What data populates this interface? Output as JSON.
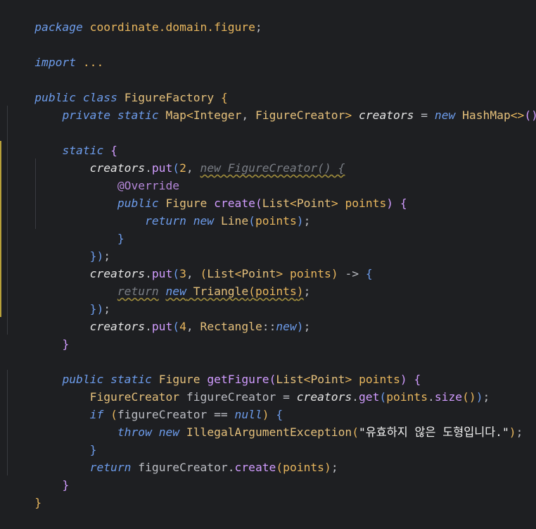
{
  "code": {
    "l1": [
      "package",
      " coordinate.domain.figure",
      ";"
    ],
    "l3": [
      "import",
      " ..."
    ],
    "l5": [
      "public",
      " ",
      "class",
      " ",
      "FigureFactory",
      " ",
      "{"
    ],
    "l6": [
      "    ",
      "private",
      " ",
      "static",
      " ",
      "Map",
      "<",
      "Integer",
      ", ",
      "FigureCreator",
      ">",
      " ",
      "creators",
      " = ",
      "new",
      " ",
      "HashMap",
      "<>",
      "(",
      ")",
      ";"
    ],
    "l8": [
      "    ",
      "static",
      " ",
      "{"
    ],
    "l9": [
      "        ",
      "creators",
      ".",
      "put",
      "(",
      "2",
      ", ",
      "new FigureCreator() {"
    ],
    "l10": [
      "            ",
      "@Override"
    ],
    "l11": [
      "            ",
      "public",
      " ",
      "Figure",
      " ",
      "create",
      "(",
      "List",
      "<",
      "Point",
      ">",
      " ",
      "points",
      ")",
      " ",
      "{"
    ],
    "l12": [
      "                ",
      "return",
      " ",
      "new",
      " ",
      "Line",
      "(",
      "points",
      ")",
      ";"
    ],
    "l13": [
      "            ",
      "}"
    ],
    "l14": [
      "        ",
      "}",
      ")",
      ";"
    ],
    "l15": [
      "        ",
      "creators",
      ".",
      "put",
      "(",
      "3",
      ", ",
      "(",
      "List",
      "<",
      "Point",
      ">",
      " ",
      "points",
      ")",
      " -> ",
      "{"
    ],
    "l16": [
      "            ",
      "return",
      " ",
      "new",
      " ",
      "Triangle",
      "(",
      "points",
      ")",
      ";"
    ],
    "l17": [
      "        ",
      "}",
      ")",
      ";"
    ],
    "l18": [
      "        ",
      "creators",
      ".",
      "put",
      "(",
      "4",
      ", ",
      "Rectangle",
      "::",
      "new",
      ")",
      ";"
    ],
    "l19": [
      "    ",
      "}"
    ],
    "l21": [
      "    ",
      "public",
      " ",
      "static",
      " ",
      "Figure",
      " ",
      "getFigure",
      "(",
      "List",
      "<",
      "Point",
      ">",
      " ",
      "points",
      ")",
      " ",
      "{"
    ],
    "l22": [
      "        ",
      "FigureCreator",
      " ",
      "figureCreator",
      " = ",
      "creators",
      ".",
      "get",
      "(",
      "points",
      ".",
      "size",
      "(",
      ")",
      ")",
      ";"
    ],
    "l23": [
      "        ",
      "if",
      " ",
      "(",
      "figureCreator",
      " == ",
      "null",
      ")",
      " ",
      "{"
    ],
    "l24": [
      "            ",
      "throw",
      " ",
      "new",
      " ",
      "IllegalArgumentException",
      "(",
      "\"유효하지 않은 도형입니다.\"",
      ")",
      ";"
    ],
    "l25": [
      "        ",
      "}"
    ],
    "l26": [
      "        ",
      "return",
      " ",
      "figureCreator",
      ".",
      "create",
      "(",
      "points",
      ")",
      ";"
    ],
    "l27": [
      "    ",
      "}"
    ],
    "l28": [
      "}"
    ]
  },
  "colors": {
    "background": "#1e1f22",
    "keyword": "#6d9ceb",
    "class": "#e5c07b",
    "string": "#f2f2f2",
    "change_marker": "#b8a13a"
  }
}
